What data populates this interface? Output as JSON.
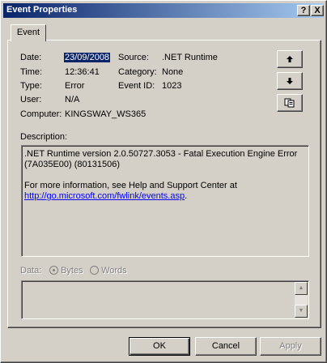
{
  "window": {
    "title": "Event Properties",
    "help_glyph": "?",
    "close_glyph": "X"
  },
  "tabs": [
    {
      "label": "Event",
      "selected": true
    }
  ],
  "fields": {
    "date_label": "Date:",
    "date_value": "23/09/2008",
    "time_label": "Time:",
    "time_value": "12:36:41",
    "type_label": "Type:",
    "type_value": "Error",
    "user_label": "User:",
    "user_value": "N/A",
    "computer_label": "Computer:",
    "computer_value": "KINGSWAY_WS365",
    "source_label": "Source:",
    "source_value": ".NET Runtime",
    "category_label": "Category:",
    "category_value": "None",
    "eventid_label": "Event ID:",
    "eventid_value": "1023"
  },
  "nav_buttons": {
    "up_glyph": "🠉",
    "down_glyph": "🠋",
    "copy_glyph": "⧉"
  },
  "description": {
    "label": "Description:",
    "line1": ".NET Runtime version 2.0.50727.3053 - Fatal Execution Engine Error (7A035E00) (80131506)",
    "line2": "For more information, see Help and Support Center at",
    "link": "http://go.microsoft.com/fwlink/events.asp",
    "link_suffix": "."
  },
  "data_section": {
    "label": "Data:",
    "bytes_label": "Bytes",
    "words_label": "Words",
    "selected": "Bytes",
    "enabled": false
  },
  "dialog_buttons": {
    "ok": "OK",
    "cancel": "Cancel",
    "apply": "Apply"
  },
  "colors": {
    "title_start": "#0a246a",
    "title_end": "#a6caf0",
    "face": "#d4d0c8",
    "link": "#0000ff"
  }
}
